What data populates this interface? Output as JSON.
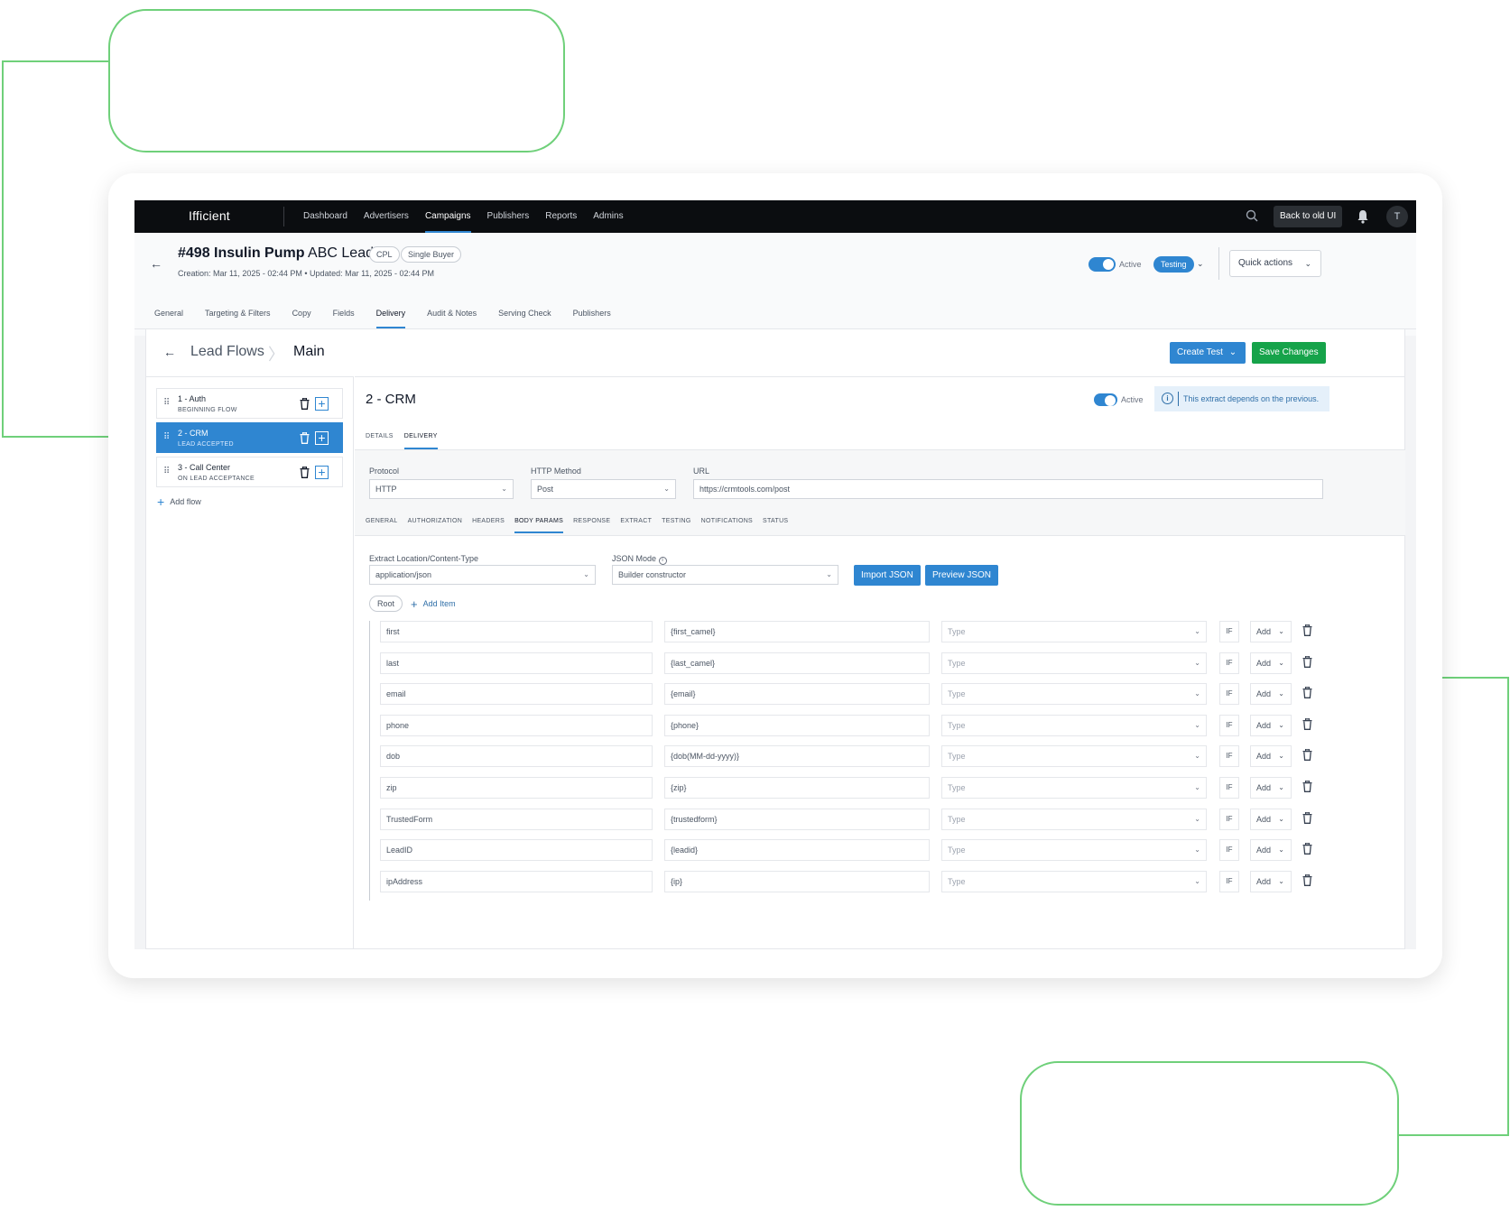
{
  "app": {
    "logo": "Ifficient",
    "nav": [
      "Dashboard",
      "Advertisers",
      "Campaigns",
      "Publishers",
      "Reports",
      "Admins"
    ],
    "nav_active": "Campaigns",
    "old_ui_button": "Back to old UI",
    "avatar_initial": "T"
  },
  "campaign": {
    "title_bold": "#498 Insulin Pump",
    "title_rest": "ABC Leads",
    "chips": [
      "CPL",
      "Single Buyer"
    ],
    "dates": "Creation: Mar 11, 2025 - 02:44 PM • Updated: Mar 11, 2025 - 02:44 PM",
    "active_label": "Active",
    "status": "Testing",
    "quick_actions": "Quick actions",
    "tabs": [
      "General",
      "Targeting & Filters",
      "Copy",
      "Fields",
      "Delivery",
      "Audit & Notes",
      "Serving Check",
      "Publishers"
    ],
    "tab_active": "Delivery"
  },
  "lead_flows": {
    "crumb_parent": "Lead Flows",
    "crumb_current": "Main",
    "create_test": "Create Test",
    "save_changes": "Save Changes",
    "flows": [
      {
        "name": "1 - Auth",
        "sub": "BEGINNING FLOW",
        "selected": false
      },
      {
        "name": "2 - CRM",
        "sub": "LEAD ACCEPTED",
        "selected": true
      },
      {
        "name": "3 - Call Center",
        "sub": "ON LEAD ACCEPTANCE",
        "selected": false
      }
    ],
    "add_flow": "Add flow"
  },
  "crm": {
    "title": "2 - CRM",
    "active_label": "Active",
    "info": "This extract depends on the previous.",
    "subtabs": [
      "DETAILS",
      "DELIVERY"
    ],
    "subtab_active": "DELIVERY",
    "protocol_label": "Protocol",
    "protocol_value": "HTTP",
    "method_label": "HTTP Method",
    "method_value": "Post",
    "url_label": "URL",
    "url_value": "https://crmtools.com/post",
    "ptabs": [
      "GENERAL",
      "AUTHORIZATION",
      "HEADERS",
      "BODY PARAMS",
      "RESPONSE",
      "EXTRACT",
      "TESTING",
      "NOTIFICATIONS",
      "STATUS"
    ],
    "ptab_active": "BODY PARAMS",
    "extract_label": "Extract Location/Content-Type",
    "extract_value": "application/json",
    "json_mode_label": "JSON Mode",
    "json_mode_value": "Builder constructor",
    "import_json": "Import JSON",
    "preview_json": "Preview JSON",
    "root": "Root",
    "add_item": "Add Item",
    "type_placeholder": "Type",
    "if_label": "IF",
    "add_label": "Add",
    "params": [
      {
        "key": "first",
        "value": "{first_camel}"
      },
      {
        "key": "last",
        "value": "{last_camel}"
      },
      {
        "key": "email",
        "value": "{email}"
      },
      {
        "key": "phone",
        "value": "{phone}"
      },
      {
        "key": "dob",
        "value": "{dob(MM-dd-yyyy)}"
      },
      {
        "key": "zip",
        "value": "{zip}"
      },
      {
        "key": "TrustedForm",
        "value": "{trustedform}"
      },
      {
        "key": "LeadID",
        "value": "{leadid}"
      },
      {
        "key": "ipAddress",
        "value": "{ip}"
      }
    ]
  },
  "colors": {
    "accent": "#2f86d1",
    "save": "#16a34a",
    "deco": "#6fd07a",
    "nav_bg": "#0b0d10"
  }
}
